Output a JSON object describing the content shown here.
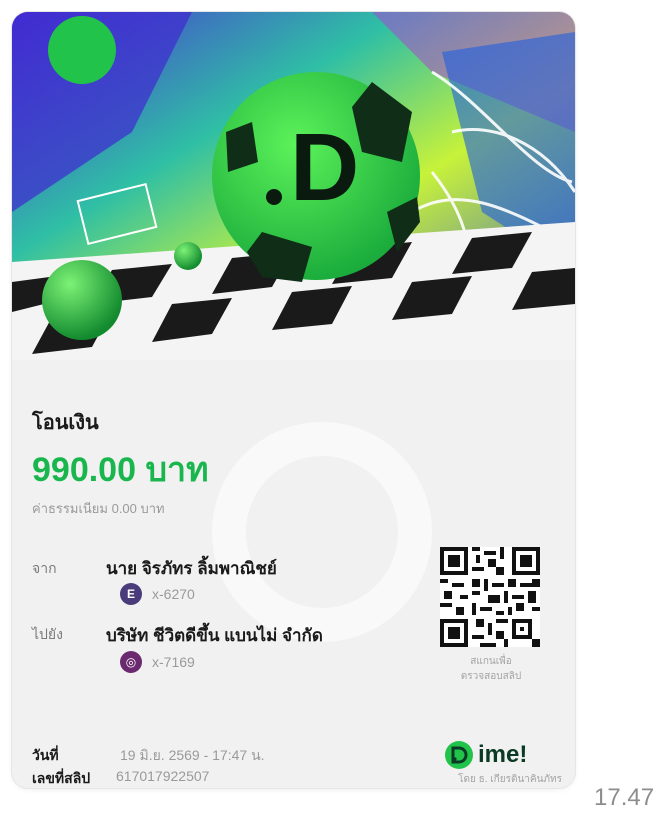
{
  "slip": {
    "title": "โอนเงิน",
    "amount": "990.00 บาท",
    "fee": "ค่าธรรมเนียม 0.00 บาท",
    "from": {
      "label": "จาก",
      "name": "นาย จิรภัทร ลิ้มพาณิชย์",
      "bank_badge": "E",
      "account": "x-6270",
      "bank_color": "#4a3b7a"
    },
    "to": {
      "label": "ไปยัง",
      "name": "บริษัท ชีวิตดีขึ้น แบนไม่ จำกัด",
      "bank_badge": "◎",
      "account": "x-7169",
      "bank_color": "#6b2a6f"
    },
    "qr_caption": "สแกนเพื่อ\nตรวจสอบสลิป",
    "date_label": "วันที่",
    "date_value": "19 มิ.ย. 2569 - 17:47 น.",
    "ref_label": "เลขที่สลิป",
    "ref_value": "617017922507",
    "brand": "ime!",
    "brand_sub": "โดย ธ. เกียรตินาคินภัทร",
    "accent_color": "#19b64d"
  },
  "message": {
    "time": "17.47"
  },
  "banner": {
    "logo_letter": "D"
  }
}
